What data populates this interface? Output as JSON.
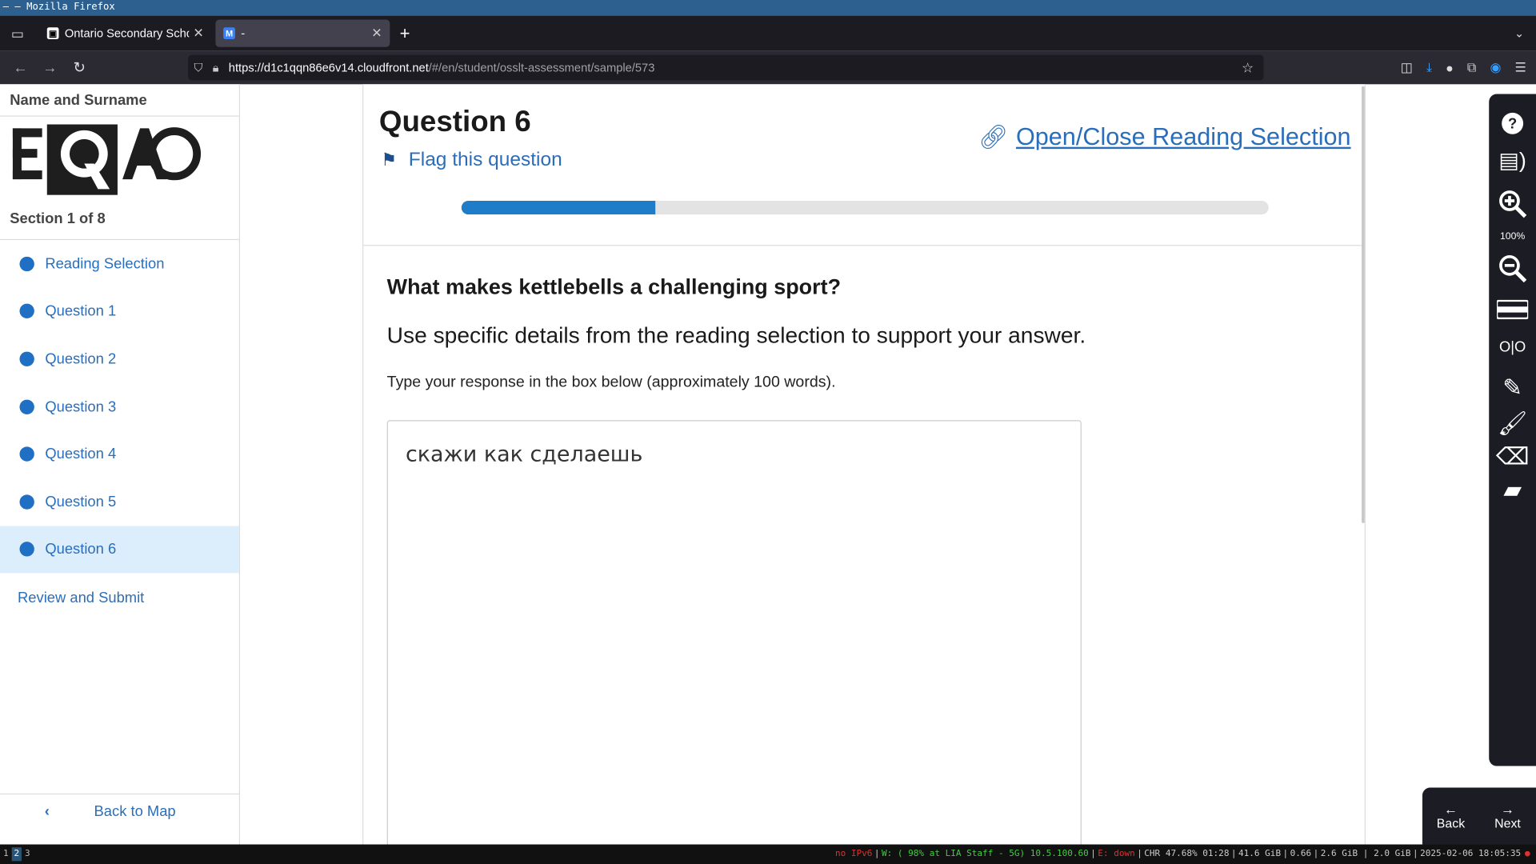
{
  "window": {
    "title": "– — Mozilla Firefox"
  },
  "tabs": [
    {
      "label": "Ontario Secondary School",
      "active": false
    },
    {
      "label": "-",
      "active": true
    }
  ],
  "url": {
    "host": "https://d1c1qqn86e6v14.cloudfront.net",
    "path": "/#/en/student/osslt-assessment/sample/573"
  },
  "sidebar": {
    "name_label": "Name and Surname",
    "logo_text": "EQAO",
    "section": "Section 1 of 8",
    "items": [
      {
        "label": "Reading Selection"
      },
      {
        "label": "Question 1"
      },
      {
        "label": "Question 2"
      },
      {
        "label": "Question 3"
      },
      {
        "label": "Question 4"
      },
      {
        "label": "Question 5"
      },
      {
        "label": "Question 6",
        "selected": true
      }
    ],
    "review_label": "Review and Submit",
    "back_label": "Back to Map"
  },
  "question": {
    "title": "Question 6",
    "flag_label": "Flag this question",
    "open_close_label": "Open/Close Reading Selection",
    "progress": 0.24,
    "prompt": "What makes kettlebells a challenging sport?",
    "instruction": "Use specific details from the reading selection to support your answer.",
    "hint": "Type your response in the box below (approximately 100 words).",
    "answer_value": "скажи как сделаешь"
  },
  "tools": {
    "zoom_level": "100%",
    "icons": [
      "help-icon",
      "text-to-speech-icon",
      "zoom-in-icon",
      "zoom-out-icon",
      "line-reader-icon",
      "hi-contrast-icon",
      "notepad-icon",
      "highlighter-icon",
      "eraser-icon",
      "sticky-note-icon"
    ]
  },
  "nav": {
    "back_label": "Back",
    "next_label": "Next"
  },
  "statusbar": {
    "workspaces": [
      "1",
      "2",
      "3"
    ],
    "ipv6": "no IPv6",
    "wifi": "W: ( 98% at LIA Staff - 5G) 10.5.100.60",
    "eth": "E: down",
    "battery": "CHR 47.68% 01:28",
    "disk": "41.6 GiB",
    "load": "0.66",
    "mem": "2.6 GiB | 2.0 GiB",
    "datetime": "2025-02-06 18:05:35"
  },
  "colors": {
    "accent": "#2a6ebb",
    "progress_fill": "#1f7cc8",
    "selected_bg": "#dceefc",
    "toolbar_bg": "#1c1c24"
  }
}
